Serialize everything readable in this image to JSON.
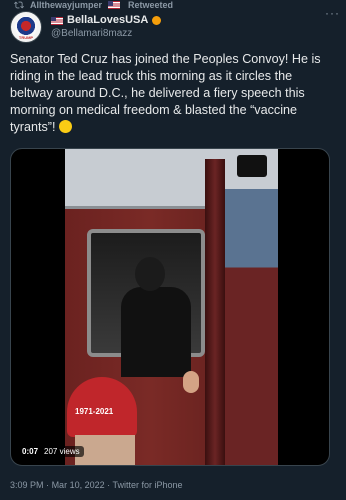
{
  "retweet": {
    "user": "Allthewayjumper",
    "label": "Retweeted"
  },
  "author": {
    "display_name": "BellaLovesUSA",
    "handle": "@Bellamari8mazz",
    "avatar_text": "TRUMP"
  },
  "tweet": {
    "text": "Senator Ted Cruz has joined the Peoples Convoy! He is riding in the lead truck this morning as it circles the beltway around D.C., he delivered a fiery speech this morning on medical freedom & blasted the “vaccine tyrants”!"
  },
  "media": {
    "duration": "0:07",
    "views": "207 views",
    "cap_text": "1971-2021"
  },
  "meta": {
    "time": "3:09 PM",
    "date": "Mar 10, 2022",
    "separator": "·",
    "source": "Twitter for iPhone"
  },
  "colors": {
    "background": "#15202b",
    "text": "#e7e9ea",
    "muted": "#8b98a5"
  }
}
